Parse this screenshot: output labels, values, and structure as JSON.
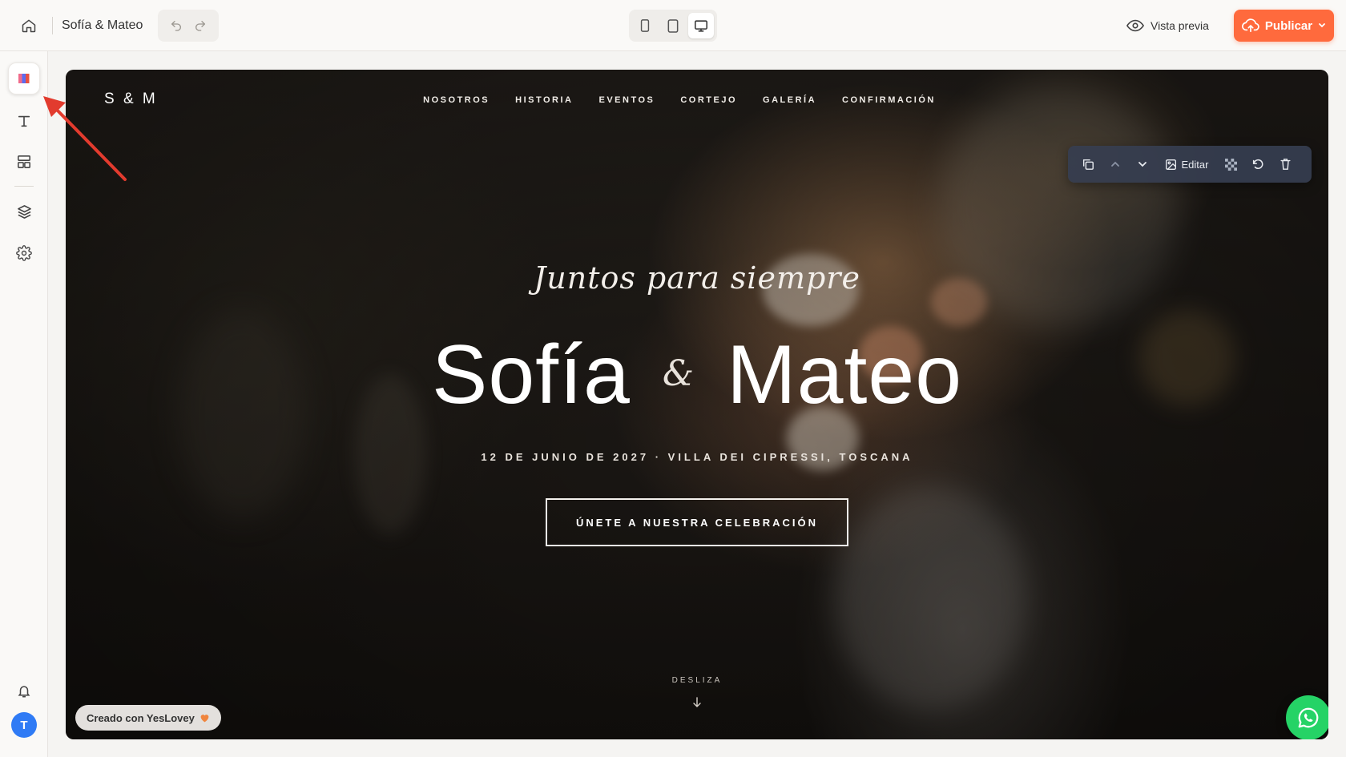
{
  "topbar": {
    "site_title": "Sofía & Mateo",
    "preview_label": "Vista previa",
    "publish_label": "Publicar"
  },
  "hero": {
    "logo": "S & M",
    "nav": [
      "NOSOTROS",
      "HISTORIA",
      "EVENTOS",
      "CORTEJO",
      "GALERÍA",
      "CONFIRMACIÓN"
    ],
    "script_title": "Juntos para siempre",
    "name_left": "Sofía",
    "ampersand": "&",
    "name_right": "Mateo",
    "event_info": "12 DE JUNIO DE 2027 · VILLA DEI CIPRESSI, TOSCANA",
    "cta_label": "ÚNETE A NUESTRA CELEBRACIÓN",
    "scroll_label": "DESLIZA"
  },
  "block_toolbar": {
    "edit_label": "Editar"
  },
  "footer_badge": {
    "label": "Creado con YesLovey"
  },
  "user": {
    "avatar_initial": "T"
  },
  "colors": {
    "accent": "#ff6a3d",
    "whatsapp": "#25d366",
    "avatar": "#2f7bf5",
    "annotation_arrow": "#e23b2e"
  }
}
